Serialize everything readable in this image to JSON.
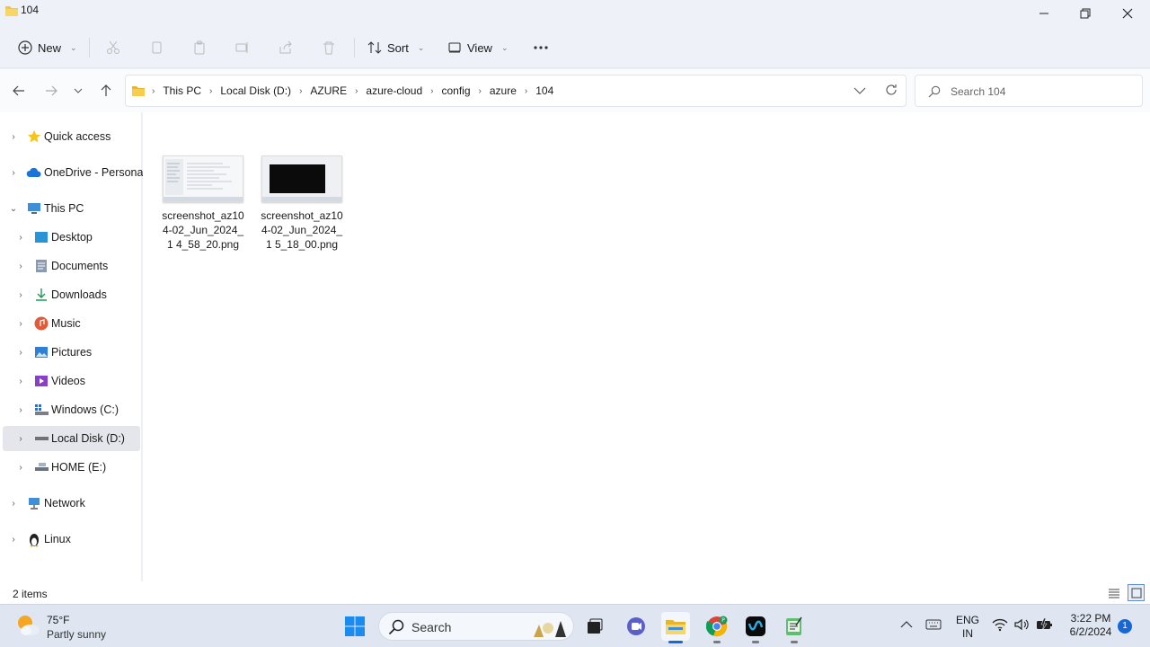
{
  "window": {
    "title": "104",
    "minimize_icon": "minimize-icon",
    "maximize_icon": "restore-icon",
    "close_icon": "close-icon"
  },
  "commandbar": {
    "new_label": "New",
    "sort_label": "Sort",
    "view_label": "View",
    "icons": [
      "cut-icon",
      "copy-icon",
      "paste-icon",
      "rename-icon",
      "share-icon",
      "delete-icon",
      "more-icon"
    ]
  },
  "address": {
    "crumbs": [
      "This PC",
      "Local Disk (D:)",
      "AZURE",
      "azure-cloud",
      "config",
      "azure",
      "104"
    ]
  },
  "search": {
    "placeholder": "Search 104"
  },
  "sidebar": {
    "items": [
      {
        "label": "Quick access",
        "icon": "star-icon"
      },
      {
        "label": "OneDrive - Personal",
        "icon": "cloud-icon"
      },
      {
        "label": "This PC",
        "icon": "computer-icon"
      },
      {
        "label": "Desktop",
        "icon": "desktop-icon"
      },
      {
        "label": "Documents",
        "icon": "documents-icon"
      },
      {
        "label": "Downloads",
        "icon": "download-icon"
      },
      {
        "label": "Music",
        "icon": "music-icon"
      },
      {
        "label": "Pictures",
        "icon": "pictures-icon"
      },
      {
        "label": "Videos",
        "icon": "videos-icon"
      },
      {
        "label": "Windows (C:)",
        "icon": "drive-icon"
      },
      {
        "label": "Local Disk (D:)",
        "icon": "drive-icon"
      },
      {
        "label": "HOME (E:)",
        "icon": "drive-icon"
      },
      {
        "label": "Network",
        "icon": "network-icon"
      },
      {
        "label": "Linux",
        "icon": "linux-icon"
      }
    ]
  },
  "files": [
    {
      "name": "screenshot_az104-02_Jun_2024_14_58_20.png",
      "display": "screenshot_az10 4-02_Jun_2024_1 4_58_20.png"
    },
    {
      "name": "screenshot_az104-02_Jun_2024_15_18_00.png",
      "display": "screenshot_az10 4-02_Jun_2024_1 5_18_00.png"
    }
  ],
  "status": {
    "item_count": "2 items"
  },
  "taskbar": {
    "weather_temp": "75°F",
    "weather_desc": "Partly sunny",
    "search_label": "Search",
    "lang_top": "ENG",
    "lang_bottom": "IN",
    "time": "3:22 PM",
    "date": "6/2/2024",
    "notification_count": "1"
  },
  "colors": {
    "accent": "#1668d6",
    "folder": "#f4c542",
    "selection": "#e4e6eb"
  }
}
